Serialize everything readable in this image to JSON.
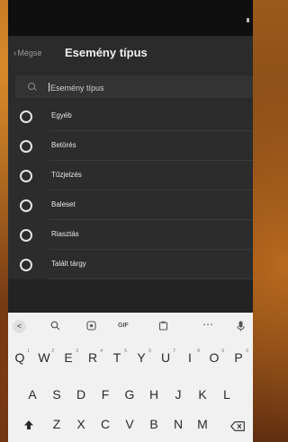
{
  "header": {
    "back_label": "Mégse",
    "title": "Esemény típus"
  },
  "search": {
    "value": "Esemény típus"
  },
  "options": [
    {
      "label": "Egyéb"
    },
    {
      "label": "Betörés"
    },
    {
      "label": "Tűzjelzés"
    },
    {
      "label": "Baleset"
    },
    {
      "label": "Riasztás"
    },
    {
      "label": "Talált tárgy"
    }
  ],
  "keyboard": {
    "toolbar": {
      "back": "<",
      "gif": "GIF",
      "more": "⋯"
    },
    "row1": [
      "Q",
      "W",
      "E",
      "R",
      "T",
      "Y",
      "U",
      "I",
      "O",
      "P"
    ],
    "row1_hints": [
      "1",
      "2",
      "3",
      "4",
      "5",
      "6",
      "7",
      "8",
      "9",
      "0"
    ],
    "row2": [
      "A",
      "S",
      "D",
      "F",
      "G",
      "H",
      "J",
      "K",
      "L"
    ],
    "row3": [
      "Z",
      "X",
      "C",
      "V",
      "B",
      "N",
      "M"
    ]
  }
}
